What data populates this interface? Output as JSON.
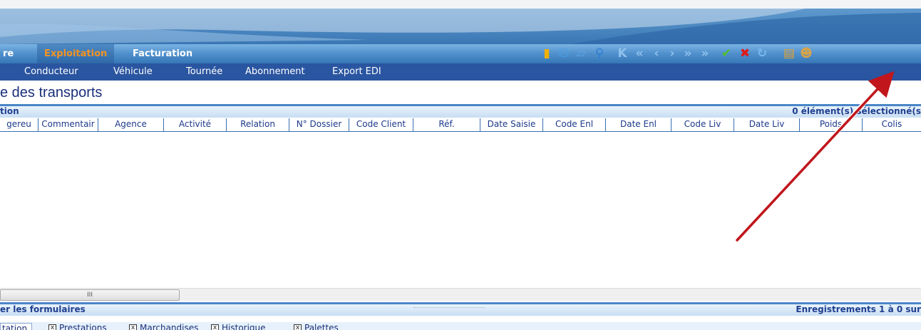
{
  "menu": {
    "tabs": [
      {
        "label": "re",
        "active": false
      },
      {
        "label": "Exploitation",
        "active": true
      },
      {
        "label": "Facturation",
        "active": false
      }
    ]
  },
  "toolbar": {
    "icons": [
      "door-icon",
      "trash-icon",
      "print-icon",
      "search-icon",
      "first-record-icon",
      "previous-page-icon",
      "previous-record-icon",
      "next-record-icon",
      "next-page-icon",
      "last-record-icon",
      "validate-icon",
      "cancel-icon",
      "refresh-icon",
      "display-icon",
      "users-icon"
    ]
  },
  "submenu": {
    "items": [
      "Conducteur",
      "Véhicule",
      "Tournée",
      "Abonnement",
      "Export EDI"
    ]
  },
  "page": {
    "title": "e des transports"
  },
  "section": {
    "left_label": "tion",
    "selection_label": "0 élément(s) sélectionné(s"
  },
  "grid": {
    "columns": [
      "gereu",
      "Commentair",
      "Agence",
      "Activité",
      "Relation",
      "N° Dossier",
      "Code Client",
      "Réf.",
      "Date Saisie",
      "Code Enl",
      "Date Enl",
      "Code Liv",
      "Date Liv",
      "Poids",
      "Colis"
    ],
    "rows": []
  },
  "scroll": {
    "thumb_label": "III"
  },
  "forms_bar": {
    "left_label": "er les formulaires",
    "records_label": "Enregistrements 1 à 0 sur"
  },
  "form_tabs": [
    {
      "label": "tation",
      "checked": false
    },
    {
      "label": "Prestations",
      "checked": true
    },
    {
      "label": "Marchandises",
      "checked": true
    },
    {
      "label": "Historique",
      "checked": true
    },
    {
      "label": "Palettes",
      "checked": true
    }
  ],
  "colors": {
    "accent": "#f39423",
    "menu_dark": "#2a55a0",
    "text_blue": "#1d3a8a",
    "arrow": "#c0161c"
  }
}
